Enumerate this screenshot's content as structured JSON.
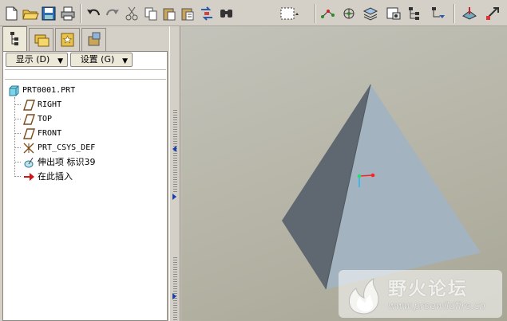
{
  "toolbar": {
    "icons": [
      "new-icon",
      "open-icon",
      "save-icon",
      "print-icon",
      "undo-icon",
      "redo-icon",
      "cut-icon",
      "copy-icon",
      "paste-icon",
      "paste-special-icon",
      "regenerate-icon",
      "search-icon",
      "select-box-icon",
      "datum-point-icon",
      "csys-icon",
      "layers-icon",
      "view-manager-icon",
      "model-tree-icon",
      "datum-plane-icon",
      "spin-center-icon",
      "help-icon"
    ]
  },
  "panel": {
    "tabs": [
      "model-tree-tab",
      "folder-browser-tab",
      "favorites-tab",
      "connections-tab"
    ],
    "show_button": "显示 (D)",
    "settings_button": "设置 (G)"
  },
  "tree": {
    "items": [
      {
        "label": "PRT0001.PRT",
        "icon": "part-icon"
      },
      {
        "label": "RIGHT",
        "icon": "datum-plane-icon"
      },
      {
        "label": "TOP",
        "icon": "datum-plane-icon"
      },
      {
        "label": "FRONT",
        "icon": "datum-plane-icon"
      },
      {
        "label": "PRT_CSYS_DEF",
        "icon": "csys-icon"
      },
      {
        "label": "伸出项 标识39",
        "icon": "protrusion-icon"
      },
      {
        "label": "在此插入",
        "icon": "insert-here-icon"
      }
    ]
  },
  "viewport": {
    "model": "pyramid",
    "background": "#b8b7aa"
  },
  "watermark": {
    "title": "野火论坛",
    "url": "www.proewildfire.cn"
  }
}
